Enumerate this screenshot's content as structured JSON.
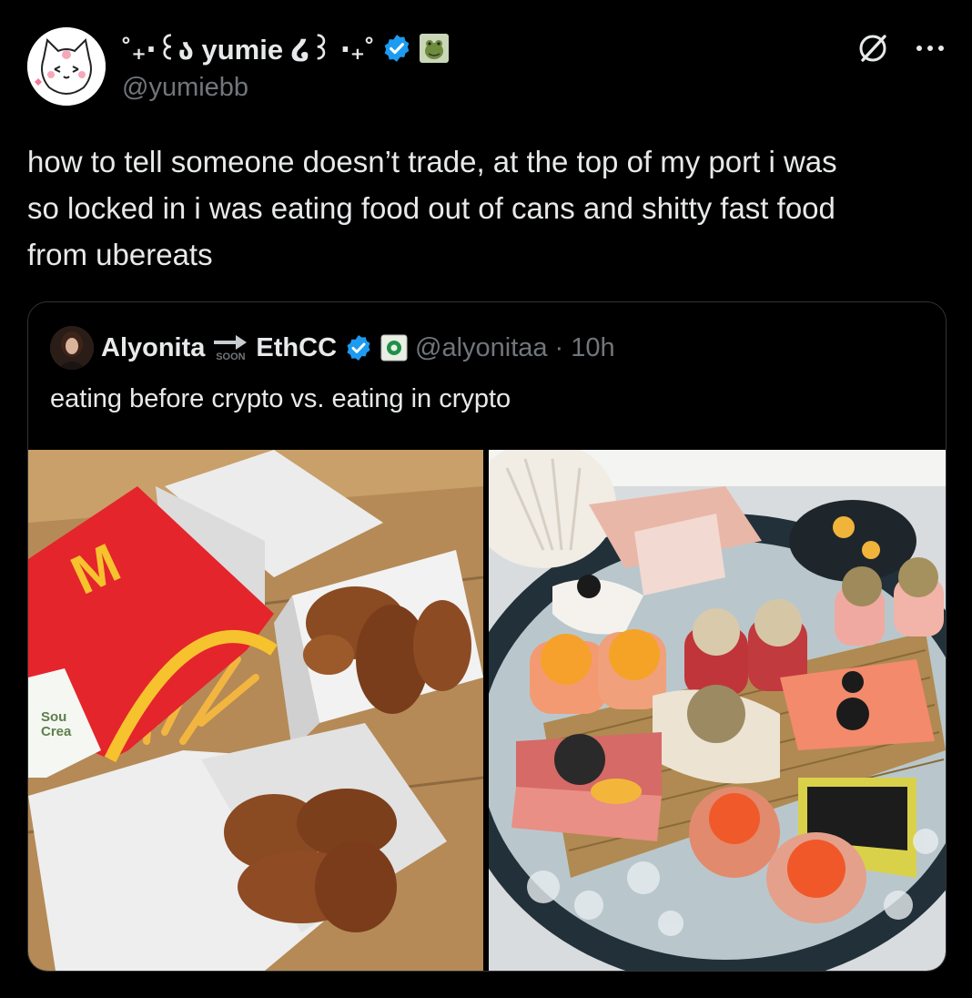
{
  "author": {
    "display_name": "˚₊‧꒰ა yumie ໒꒱ ‧₊˚",
    "handle": "@yumiebb"
  },
  "tweet": {
    "line1": "how to tell someone doesn’t trade, at the top of my port i was",
    "line2": "so locked in i was eating food out of cans and shitty fast food",
    "line3": "from ubereats"
  },
  "quote": {
    "name": "Alyonita",
    "soon_label": "SOON",
    "event_name": "EthCC",
    "handle": "@alyonitaa",
    "time": "· 10h",
    "text": "eating before crypto vs. eating in crypto"
  },
  "media_text": {
    "packet_label": "Sou\nCrea",
    "logo": "M"
  },
  "colors": {
    "background": "#000000",
    "text_primary": "#e7e9ea",
    "text_secondary": "#71767b",
    "verified_blue": "#1d9bf0",
    "border": "#2f3336"
  },
  "icons": {
    "verified": "verified-badge-icon",
    "grok": "grok-icon",
    "more": "more-icon",
    "arrow": "arrow-right-icon",
    "affiliate": "affiliate-badge-icon",
    "nft_avatar_badge": "frog-badge-icon"
  }
}
